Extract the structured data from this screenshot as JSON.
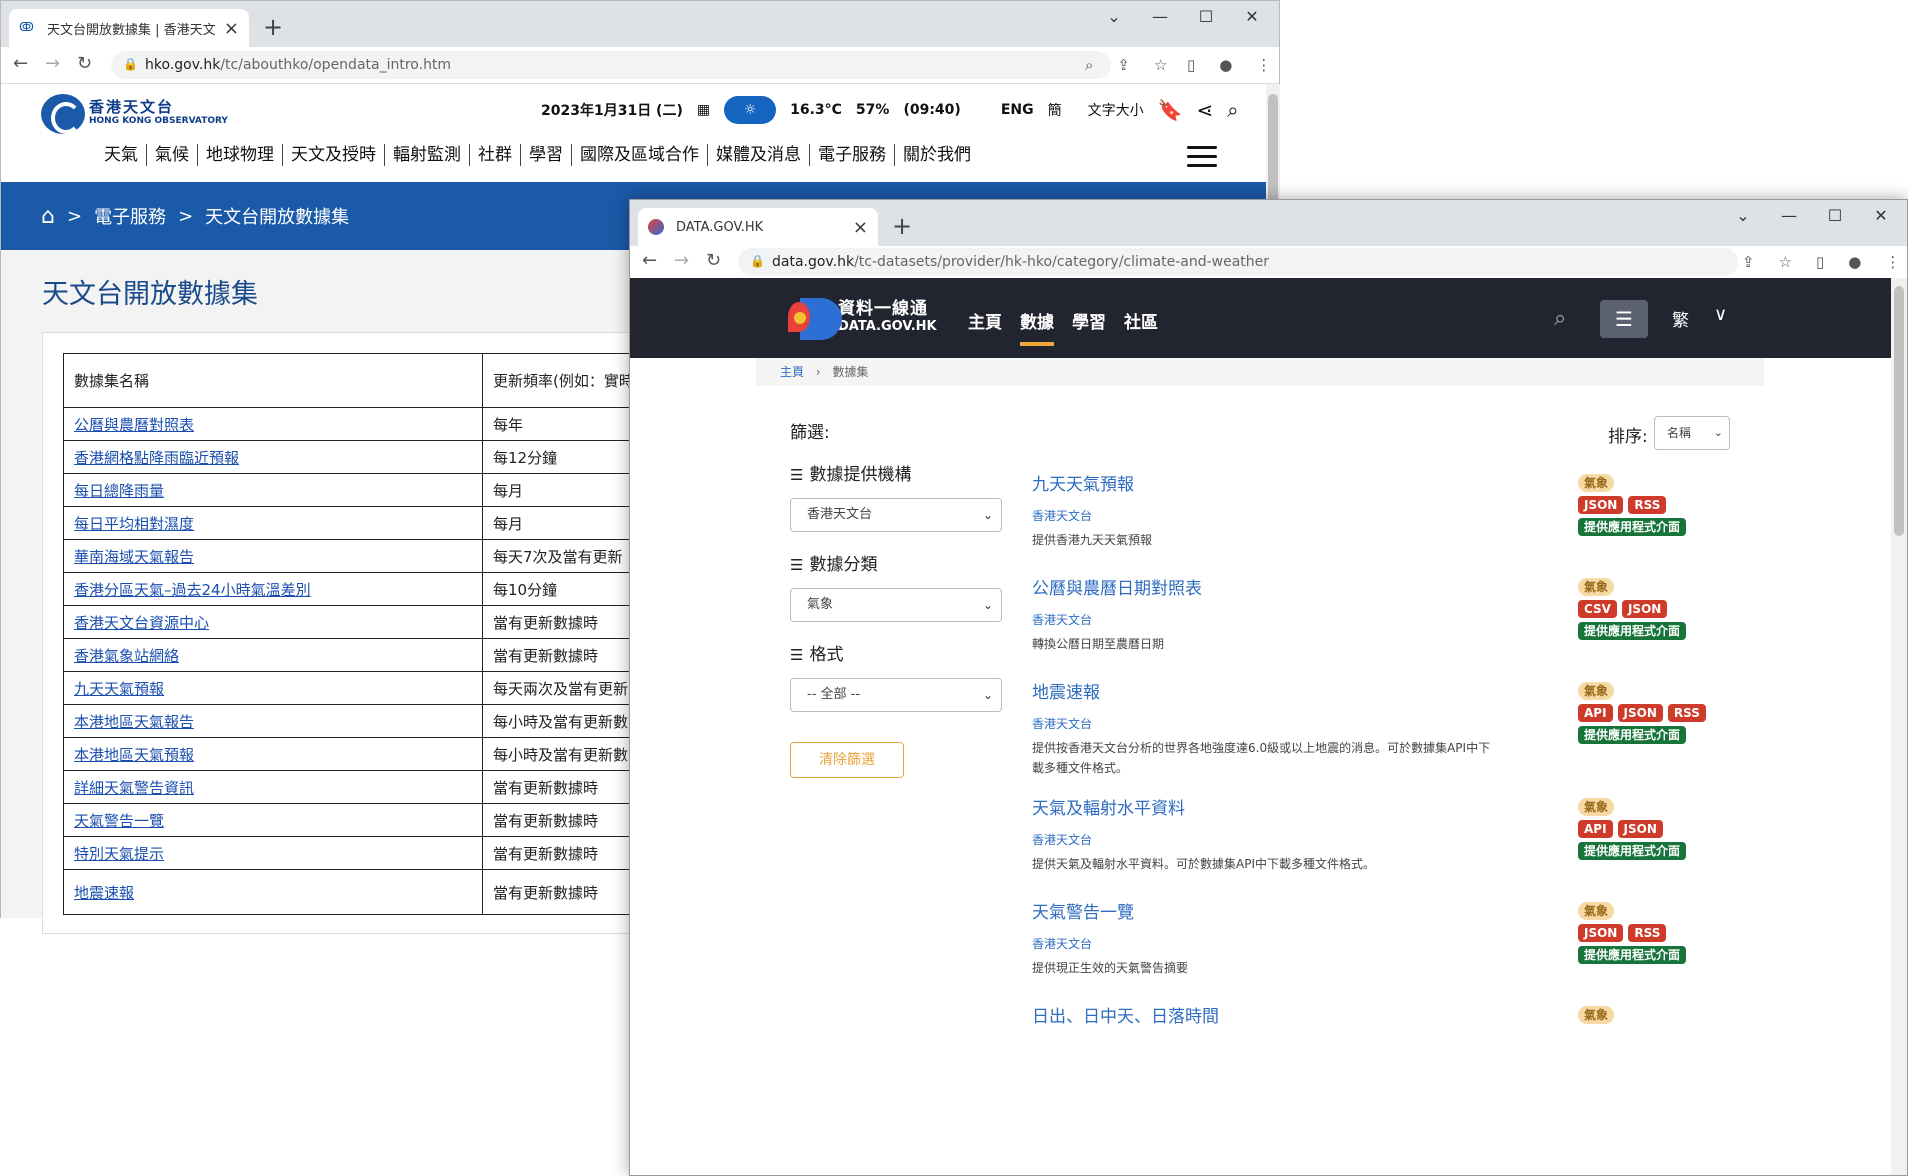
{
  "win1": {
    "tab_title": "天文台開放數據集 | 香港天文台(",
    "url_host": "hko.gov.hk",
    "url_path": "/tc/abouthko/opendata_intro.htm",
    "logo_zh": "香港天文台",
    "logo_en": "HONG KONG OBSERVATORY",
    "date": "2023年1月31日 (二)",
    "temp": "16.3°C",
    "humidity": "57%",
    "time": "(09:40)",
    "lang_eng": "ENG",
    "lang_sc": "簡",
    "font_size": "文字大小",
    "nav": [
      "天氣",
      "氣候",
      "地球物理",
      "天文及授時",
      "輻射監測",
      "社群",
      "學習",
      "國際及區域合作",
      "媒體及消息",
      "電子服務",
      "關於我們"
    ],
    "breadcrumb": [
      "電子服務",
      "天文台開放數據集"
    ],
    "page_title": "天文台開放數據集",
    "table": {
      "h1": "數據集名稱",
      "h2": "更新頻率(例如：實時、每日、每星期、每月等)",
      "rows": [
        {
          "name": "公曆與農曆對照表",
          "freq": "每年"
        },
        {
          "name": "香港網格點降雨臨近預報",
          "freq": "每12分鐘"
        },
        {
          "name": "每日總降雨量",
          "freq": "每月"
        },
        {
          "name": "每日平均相對濕度",
          "freq": "每月"
        },
        {
          "name": "華南海域天氣報告",
          "freq": "每天7次及當有更新"
        },
        {
          "name": "香港分區天氣–過去24小時氣溫差別",
          "freq": "每10分鐘"
        },
        {
          "name": "香港天文台資源中心",
          "freq": "當有更新數據時"
        },
        {
          "name": "香港氣象站網絡",
          "freq": "當有更新數據時"
        },
        {
          "name": "九天天氣預報",
          "freq": "每天兩次及當有更新"
        },
        {
          "name": "本港地區天氣報告",
          "freq": "每小時及當有更新數"
        },
        {
          "name": "本港地區天氣預報",
          "freq": "每小時及當有更新數"
        },
        {
          "name": "詳細天氣警告資訊",
          "freq": "當有更新數據時"
        },
        {
          "name": "天氣警告一覽",
          "freq": "當有更新數據時"
        },
        {
          "name": "特別天氣提示",
          "freq": "當有更新數據時"
        },
        {
          "name": "地震速報",
          "freq": "當有更新數據時"
        }
      ]
    }
  },
  "win2": {
    "tab_title": "DATA.GOV.HK",
    "url_host": "data.gov.hk",
    "url_path": "/tc-datasets/provider/hk-hko/category/climate-and-weather",
    "logo_zh": "資料一線通",
    "logo_en": "DATA.GOV.HK",
    "menu": [
      "主頁",
      "數據",
      "學習",
      "社區"
    ],
    "lang": "繁",
    "breadcrumb": [
      "主頁",
      "數據集"
    ],
    "filter_title": "篩選:",
    "filters": [
      {
        "label": "數據提供機構",
        "value": "香港天文台"
      },
      {
        "label": "數據分類",
        "value": "氣象"
      },
      {
        "label": "格式",
        "value": "-- 全部 --"
      }
    ],
    "clear_label": "清除篩選",
    "sort_label": "排序:",
    "sort_value": "名稱",
    "datasets": [
      {
        "title": "九天天氣預報",
        "provider": "香港天文台",
        "desc": "提供香港九天天氣預報",
        "category": "氣象",
        "formats": [
          "JSON",
          "RSS"
        ],
        "api": "提供應用程式介面"
      },
      {
        "title": "公曆與農曆日期對照表",
        "provider": "香港天文台",
        "desc": "轉換公曆日期至農曆日期",
        "category": "氣象",
        "formats": [
          "CSV",
          "JSON"
        ],
        "api": "提供應用程式介面"
      },
      {
        "title": "地震速報",
        "provider": "香港天文台",
        "desc": "提供按香港天文台分析的世界各地強度達6.0級或以上地震的消息。可於數據集API中下載多種文件格式。",
        "category": "氣象",
        "formats": [
          "API",
          "JSON",
          "RSS"
        ],
        "api": "提供應用程式介面"
      },
      {
        "title": "天氣及輻射水平資料",
        "provider": "香港天文台",
        "desc": "提供天氣及輻射水平資料。可於數據集API中下載多種文件格式。",
        "category": "氣象",
        "formats": [
          "API",
          "JSON"
        ],
        "api": "提供應用程式介面"
      },
      {
        "title": "天氣警告一覽",
        "provider": "香港天文台",
        "desc": "提供現正生效的天氣警告摘要",
        "category": "氣象",
        "formats": [
          "JSON",
          "RSS"
        ],
        "api": "提供應用程式介面"
      },
      {
        "title": "日出、日中天、日落時間",
        "provider": "",
        "desc": "",
        "category": "氣象",
        "formats": [],
        "api": ""
      }
    ]
  }
}
